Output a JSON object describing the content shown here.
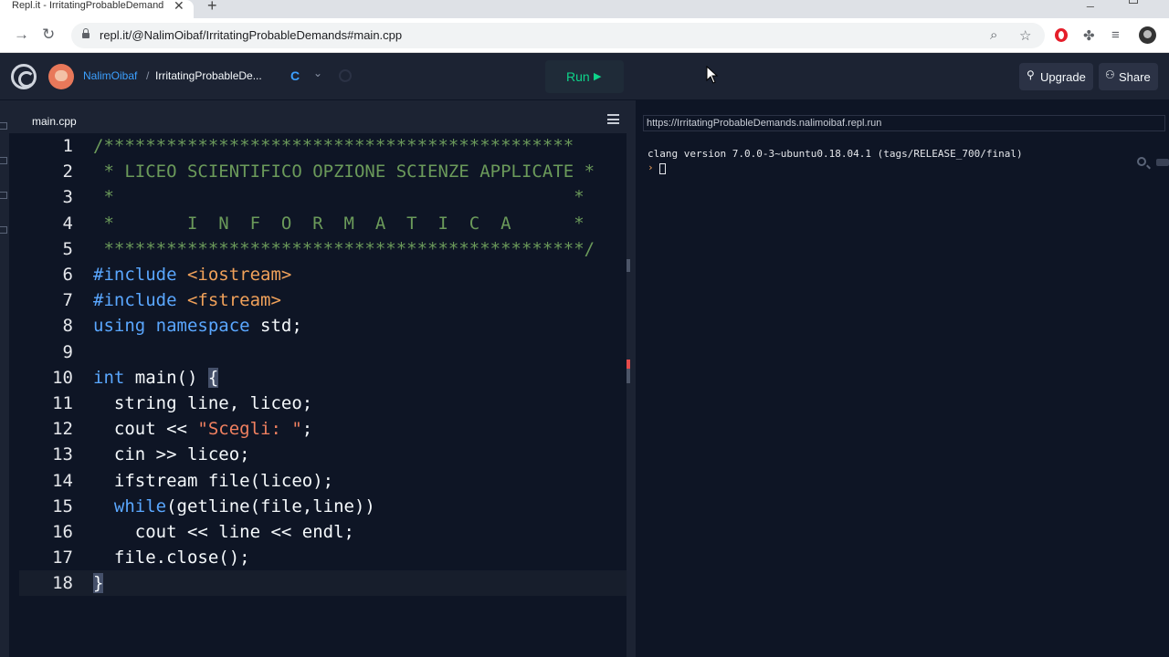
{
  "browser": {
    "tab_title": "Repl.it - IrritatingProbableDemand",
    "tab_close": "✕",
    "new_tab": "+",
    "url": "repl.it/@NalimOibaf/IrritatingProbableDemands#main.cpp",
    "back": "→",
    "reload": "↻"
  },
  "header": {
    "username": "NalimOibaf",
    "separator": "/",
    "repl_name": "IrritatingProbableDe...",
    "lang_icon": "C",
    "lang_caret": "⌄",
    "run_label": "Run",
    "run_arrow": "▶",
    "upgrade_label": "Upgrade",
    "upgrade_icon": "⚲",
    "share_label": "Share",
    "share_icon": "⚇"
  },
  "editor": {
    "file_tab": "main.cpp",
    "active_line": 18,
    "lines": [
      {
        "n": "1",
        "segments": [
          {
            "t": "/*********************************************",
            "c": "cm"
          }
        ]
      },
      {
        "n": "2",
        "segments": [
          {
            "t": " * LICEO SCIENTIFICO OPZIONE SCIENZE APPLICATE *",
            "c": "cm"
          }
        ]
      },
      {
        "n": "3",
        "segments": [
          {
            "t": " *                                            *",
            "c": "cm"
          }
        ]
      },
      {
        "n": "4",
        "segments": [
          {
            "t": " *       I  N  F  O  R  M  A  T  I  C  A      *",
            "c": "cm"
          }
        ]
      },
      {
        "n": "5",
        "segments": [
          {
            "t": " **********************************************/",
            "c": "cm"
          }
        ]
      },
      {
        "n": "6",
        "segments": [
          {
            "t": "#include ",
            "c": "pp"
          },
          {
            "t": "<iostream>",
            "c": "inc"
          }
        ]
      },
      {
        "n": "7",
        "segments": [
          {
            "t": "#include ",
            "c": "pp"
          },
          {
            "t": "<fstream>",
            "c": "inc"
          }
        ]
      },
      {
        "n": "8",
        "segments": [
          {
            "t": "using namespace ",
            "c": "kw"
          },
          {
            "t": "std;",
            "c": ""
          }
        ]
      },
      {
        "n": "9",
        "segments": []
      },
      {
        "n": "10",
        "segments": [
          {
            "t": "int ",
            "c": "kw"
          },
          {
            "t": "main() ",
            "c": ""
          },
          {
            "t": "{",
            "c": "cursor-bracket"
          }
        ]
      },
      {
        "n": "11",
        "segments": [
          {
            "t": "  string line, liceo;",
            "c": ""
          }
        ]
      },
      {
        "n": "12",
        "segments": [
          {
            "t": "  cout << ",
            "c": ""
          },
          {
            "t": "\"Scegli: \"",
            "c": "str"
          },
          {
            "t": ";",
            "c": ""
          }
        ]
      },
      {
        "n": "13",
        "segments": [
          {
            "t": "  cin >> liceo;",
            "c": ""
          }
        ]
      },
      {
        "n": "14",
        "segments": [
          {
            "t": "  ifstream file(liceo);",
            "c": ""
          }
        ]
      },
      {
        "n": "15",
        "segments": [
          {
            "t": "  ",
            "c": ""
          },
          {
            "t": "while",
            "c": "kw"
          },
          {
            "t": "(getline(file,line))",
            "c": ""
          }
        ]
      },
      {
        "n": "16",
        "segments": [
          {
            "t": "    cout << line << endl;",
            "c": ""
          }
        ]
      },
      {
        "n": "17",
        "segments": [
          {
            "t": "  file.close();",
            "c": ""
          }
        ]
      },
      {
        "n": "18",
        "segments": [
          {
            "t": "}",
            "c": "cursor-bracket"
          }
        ]
      }
    ]
  },
  "console": {
    "url": "https://IrritatingProbableDemands.nalimoibaf.repl.run",
    "output": "clang version 7.0.0-3~ubuntu0.18.04.1 (tags/RELEASE_700/final)",
    "prompt": "›"
  }
}
